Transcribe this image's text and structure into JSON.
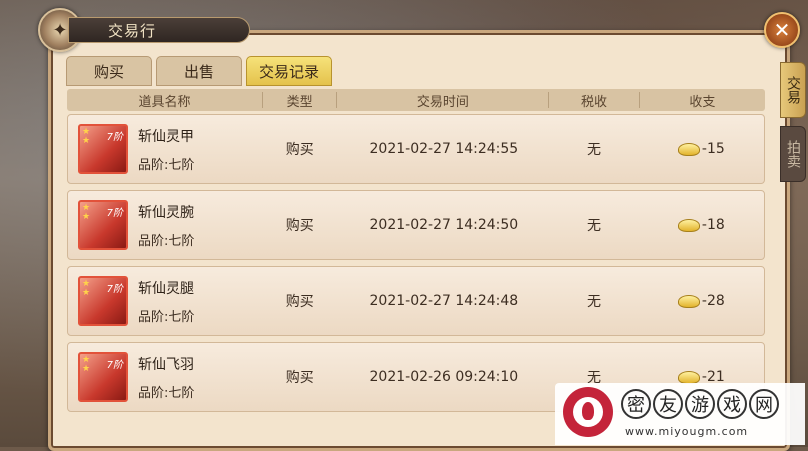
{
  "window": {
    "title": "交易行",
    "close_label": "✕"
  },
  "tabs": [
    {
      "label": "购买"
    },
    {
      "label": "出售"
    },
    {
      "label": "交易记录"
    }
  ],
  "side_tabs": [
    {
      "label": "交易"
    },
    {
      "label": "拍卖"
    }
  ],
  "table": {
    "headers": [
      "道具名称",
      "类型",
      "交易时间",
      "税收",
      "收支"
    ],
    "rows": [
      {
        "name": "斩仙灵甲",
        "grade": "品阶:七阶",
        "type": "购买",
        "time": "2021-02-27  14:24:55",
        "tax": "无",
        "amount": "-15",
        "tier": "7阶"
      },
      {
        "name": "斩仙灵腕",
        "grade": "品阶:七阶",
        "type": "购买",
        "time": "2021-02-27  14:24:50",
        "tax": "无",
        "amount": "-18",
        "tier": "7阶"
      },
      {
        "name": "斩仙灵腿",
        "grade": "品阶:七阶",
        "type": "购买",
        "time": "2021-02-27  14:24:48",
        "tax": "无",
        "amount": "-28",
        "tier": "7阶"
      },
      {
        "name": "斩仙飞羽",
        "grade": "品阶:七阶",
        "type": "购买",
        "time": "2021-02-26  09:24:10",
        "tax": "无",
        "amount": "-21",
        "tier": "7阶"
      }
    ]
  },
  "watermark": {
    "chars": [
      "密",
      "友",
      "游",
      "戏",
      "网"
    ],
    "url": "www.miyougm.com"
  },
  "colors": {
    "active_tab": "#e4c24c",
    "panel": "#f3e4cd",
    "item_icon": "#c8382c"
  }
}
